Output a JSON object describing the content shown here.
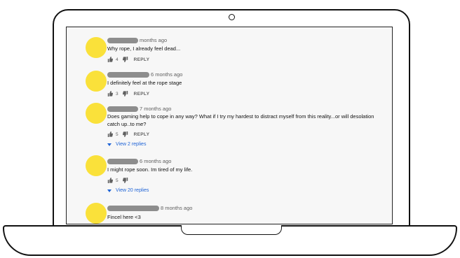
{
  "comments": [
    {
      "time": "months ago",
      "text": "Why rope, I already feel dead...",
      "likes": "4",
      "reply_label": "REPLY",
      "view_replies": ""
    },
    {
      "time": "6 months ago",
      "text": "I definitely feel at the rope stage",
      "likes": "3",
      "reply_label": "REPLY",
      "view_replies": ""
    },
    {
      "time": "7 months ago",
      "text": "Does gaming help to cope in any way? What if I try my hardest to distract myself from this reality...or will desolation catch up..to me?",
      "likes": "5",
      "reply_label": "REPLY",
      "view_replies": "View 2 replies"
    },
    {
      "time": "6 months ago",
      "text": "I might rope soon. Im tired of my life.",
      "likes": "5",
      "reply_label": "",
      "view_replies": "View 20 replies"
    },
    {
      "time": "8 months ago",
      "text": "Fincel here <3",
      "likes": "",
      "reply_label": "",
      "view_replies": ""
    }
  ],
  "colors": {
    "avatar": "#fae13a",
    "link": "#1e63d6",
    "muted": "#606060",
    "redacted_name": "#8d8d8d"
  },
  "icons": [
    "thumbs-up-icon",
    "thumbs-down-icon",
    "caret-down-icon",
    "camera-icon"
  ]
}
